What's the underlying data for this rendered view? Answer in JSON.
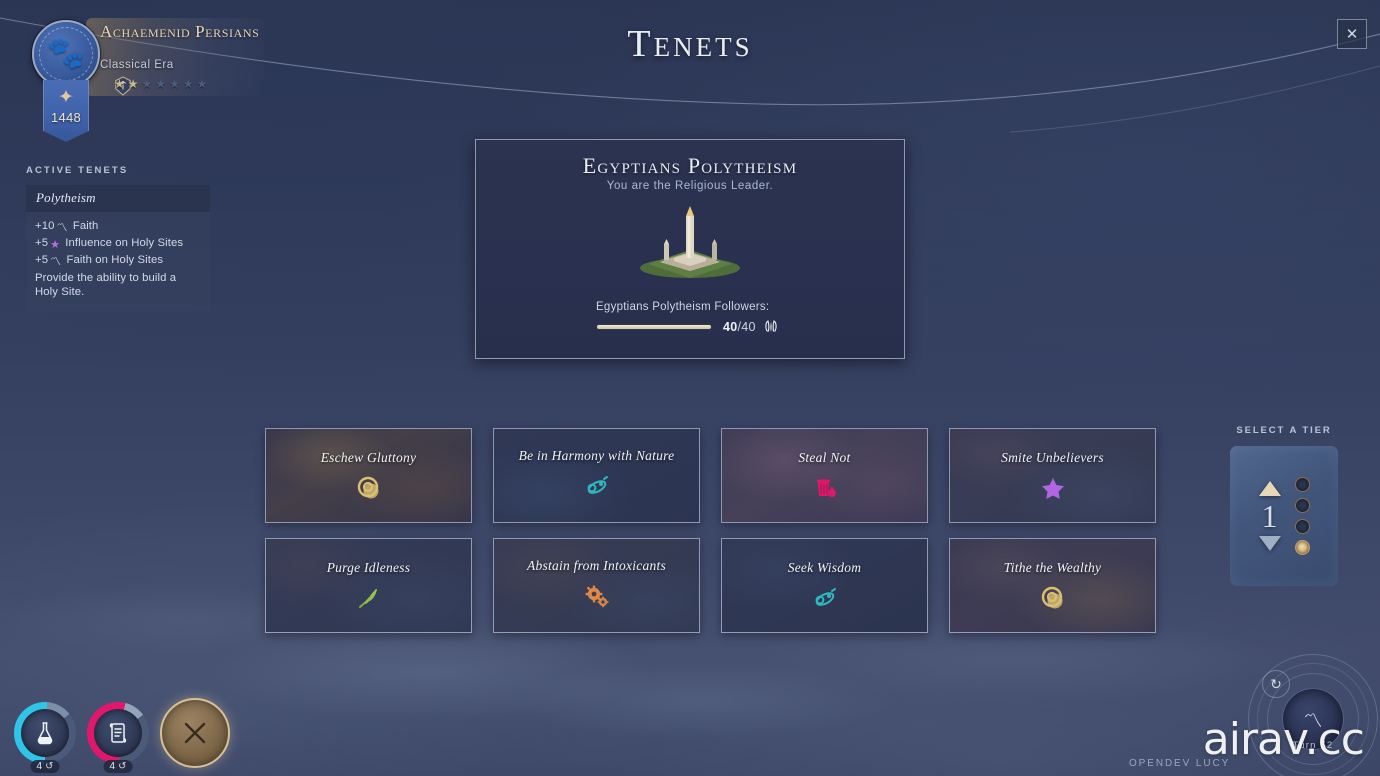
{
  "header": {
    "title": "Tenets",
    "close_label": "✕"
  },
  "player": {
    "civ_name": "Achaemenid Persians",
    "era": "Classical Era",
    "seal_glyph": "🐾",
    "crest_glyph": "✦",
    "banner_number": "1448",
    "rank_icon": "rank-emblem-icon",
    "stars_total": 7,
    "stars_filled": 2
  },
  "active_tenets": {
    "section_label": "Active Tenets",
    "cards": [
      {
        "name": "Polytheism",
        "effects": [
          {
            "prefix": "+10",
            "icon": "faith-icon",
            "icon_glyph": "〽",
            "icon_class": "icon-faith",
            "text": "Faith"
          },
          {
            "prefix": "+5",
            "icon": "influence-icon",
            "icon_glyph": "★",
            "icon_class": "icon-infl",
            "text": "Influence on Holy Sites"
          },
          {
            "prefix": "+5",
            "icon": "faith-icon",
            "icon_glyph": "〽",
            "icon_class": "icon-faith",
            "text": "Faith on Holy Sites"
          }
        ],
        "description": "Provide the ability to build a Holy Site."
      }
    ]
  },
  "religion_card": {
    "title": "Egyptians Polytheism",
    "subtitle": "You are the Religious Leader.",
    "art_name": "obelisk-monument-art",
    "followers_label": "Egyptians Polytheism Followers:",
    "followers_current": "40",
    "followers_max": "40",
    "followers_separator": "/",
    "followers_icon": "followers-icon",
    "progress_percent": 100
  },
  "tenets": [
    {
      "name": "Eschew Gluttony",
      "icon": "gold-coin-icon",
      "icon_glyph": "◎",
      "icon_color": "#dcc071",
      "bg": "bg-gluttony",
      "lines": 1
    },
    {
      "name": "Be in Harmony with Nature",
      "icon": "science-atom-icon",
      "icon_glyph": "⚛",
      "icon_color": "#2fb9bd",
      "bg": "bg-harmony",
      "lines": 2
    },
    {
      "name": "Steal Not",
      "icon": "production-icon",
      "icon_glyph": "⛁",
      "icon_color": "#e0176b",
      "bg": "bg-steal",
      "lines": 1
    },
    {
      "name": "Smite Unbelievers",
      "icon": "influence-star-icon",
      "icon_glyph": "★",
      "icon_color": "#b264e2",
      "bg": "bg-smite",
      "lines": 1
    },
    {
      "name": "Purge Idleness",
      "icon": "food-leaf-icon",
      "icon_glyph": "🌿",
      "icon_color": "#9cc54e",
      "bg": "bg-purge",
      "lines": 1
    },
    {
      "name": "Abstain from Intoxicants",
      "icon": "production-gear-icon",
      "icon_glyph": "⚙",
      "icon_color": "#e08945",
      "bg": "bg-abstain",
      "lines": 2
    },
    {
      "name": "Seek Wisdom",
      "icon": "science-atom-icon",
      "icon_glyph": "⚛",
      "icon_color": "#2fb9bd",
      "bg": "bg-wisdom",
      "lines": 1
    },
    {
      "name": "Tithe the Wealthy",
      "icon": "gold-coin-icon",
      "icon_glyph": "◎",
      "icon_color": "#dcc071",
      "bg": "bg-tithe",
      "lines": 1
    }
  ],
  "tier_selector": {
    "label": "Select a Tier",
    "value": "1",
    "up_icon": "triangle-up-icon",
    "down_icon": "triangle-down-icon",
    "dots_total": 4,
    "active_dot_index": 3
  },
  "bottom_bar": {
    "science": {
      "name": "science-yield",
      "value": "4",
      "turn_icon": "turn-icon",
      "turn_glyph": "↺",
      "glyph": "⚗",
      "color": "#30c5e8"
    },
    "culture": {
      "name": "culture-yield",
      "value": "4",
      "turn_icon": "turn-icon",
      "turn_glyph": "↺",
      "glyph": "📜",
      "color": "#e0176b"
    },
    "close_round_glyph": "✕"
  },
  "turn_dial": {
    "label": "Turn 52",
    "core_glyph": "〽",
    "refresh_glyph": "↻"
  },
  "footer": {
    "dev_tag": "OPENDEV LUCY",
    "watermark": "airav.cc"
  },
  "colors": {
    "background": "#394263",
    "panel": "#2b3350",
    "accent_gold": "#e6d8b6",
    "science": "#30c5e8",
    "culture": "#e0176b",
    "faith": "#eef2f8"
  }
}
